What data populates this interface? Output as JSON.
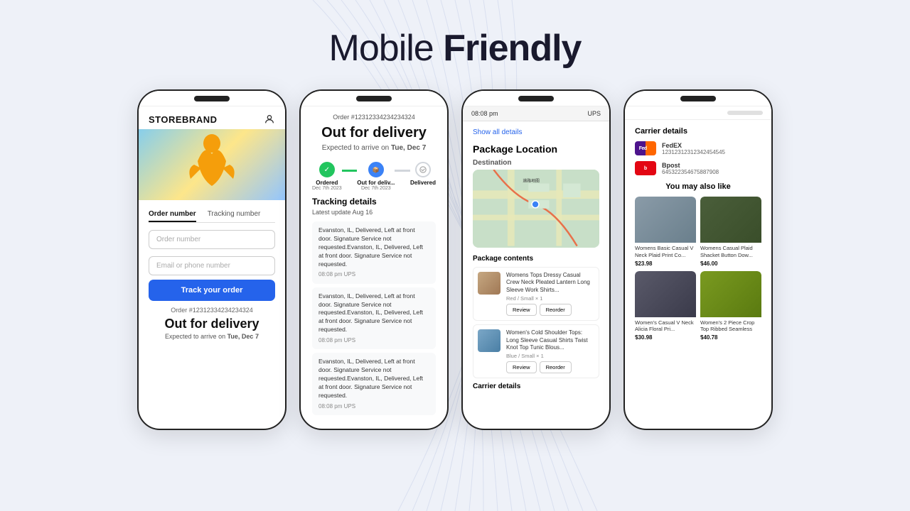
{
  "header": {
    "title_light": "Mobile ",
    "title_bold": "Friendly"
  },
  "phone1": {
    "brand": "STOREBRAND",
    "tab1": "Order number",
    "tab2": "Tracking number",
    "input1_placeholder": "Order number",
    "input2_placeholder": "Email or phone number",
    "btn_label": "Track your order",
    "order_label": "Order #12312334234234324",
    "status": "Out for delivery",
    "expected": "Expected to arrive on ",
    "expected_date": "Tue, Dec 7"
  },
  "phone2": {
    "order_id": "Order #12312334234234324",
    "title": "Out for delivery",
    "subtitle_pre": "Expected to arrive on ",
    "subtitle_date": "Tue, Dec 7",
    "step1_label": "Ordered",
    "step1_date": "Dec 7th 2023",
    "step2_label": "Out for deliv...",
    "step2_date": "Dec 7th 2023",
    "step3_label": "Delivered",
    "tracking_title": "Tracking details",
    "latest_update": "Latest update Aug 16",
    "event1": "Evanston, IL, Delivered, Left at front door. Signature Service not requested.Evanston, IL, Delivered, Left at front door. Signature Service not requested.",
    "event1_meta": "08:08 pm   UPS",
    "event2": "Evanston, IL, Delivered, Left at front door. Signature Service not requested.Evanston, IL, Delivered, Left at front door. Signature Service not requested.",
    "event2_meta": "08:08 pm   UPS",
    "event3": "Evanston, IL, Delivered, Left at front door. Signature Service not requested.Evanston, IL, Delivered, Left at front door. Signature Service not requested.",
    "event3_meta": "08:08 pm   UPS"
  },
  "phone3": {
    "time": "08:08 pm",
    "carrier": "UPS",
    "show_all": "Show all details",
    "section_title": "Package Location",
    "destination_label": "Destination",
    "package_contents": "Package contents",
    "item1_name": "Womens Tops Dressy Casual Crew Neck Pleated Lantern Long Sleeve Work Shirts...",
    "item1_meta": "Red / Small  × 1",
    "item2_name": "Women's Cold Shoulder Tops: Long Sleeve Casual Shirts Twist Knot Top Tunic Blous...",
    "item2_meta": "Blue / Small  × 1",
    "btn_review": "Review",
    "btn_reorder": "Reorder",
    "carrier_details": "Carrier details"
  },
  "phone4": {
    "carrier_title": "Carrier details",
    "carrier1_name": "FedEX",
    "carrier1_num": "12312312312342454545",
    "carrier2_name": "Bpost",
    "carrier2_num": "645322354675887908",
    "rec_title": "You may also like",
    "product1_name": "Womens Basic Casual V Neck Plaid Print Co...",
    "product1_price": "$23.98",
    "product2_name": "Womens Casual Plaid Shacket Button Dow...",
    "product2_price": "$46.00",
    "product3_name": "Women's Casual V Neck Alicia Floral Pri...",
    "product3_price": "$30.98",
    "product4_name": "Women's 2 Piece Crop Top Ribbed Seamless",
    "product4_price": "$40.78"
  }
}
